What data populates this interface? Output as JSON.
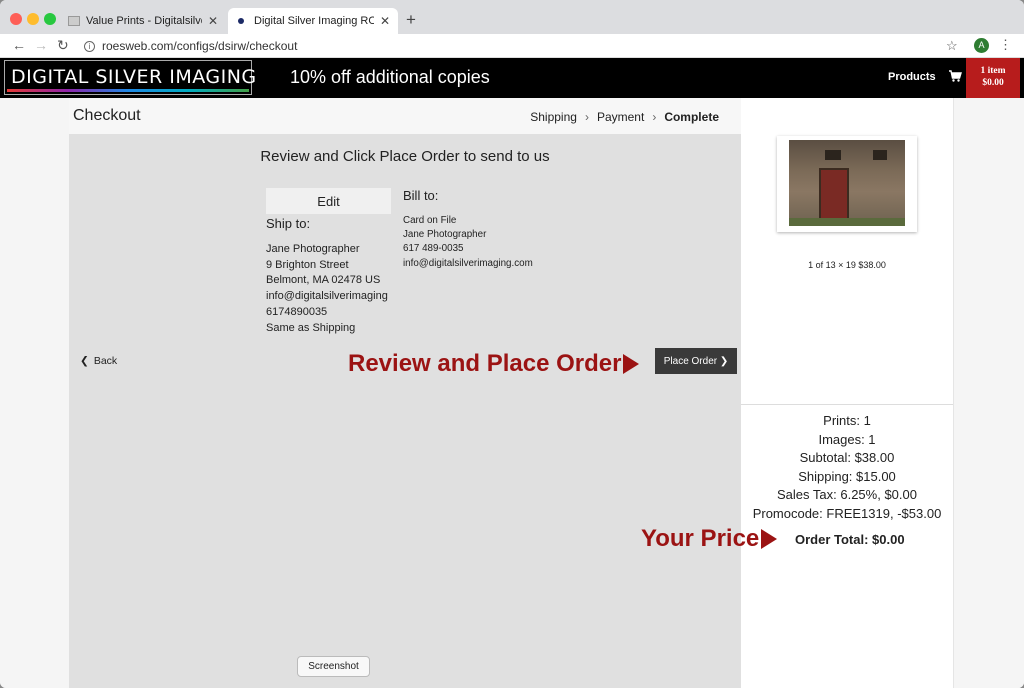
{
  "browser": {
    "tabs": [
      {
        "title": "Value Prints - Digitalsilverimag",
        "active": false
      },
      {
        "title": "Digital Silver Imaging ROES We",
        "active": true
      }
    ],
    "url": "roesweb.com/configs/dsirw/checkout",
    "profile_initial": "A"
  },
  "header": {
    "logo_text": "DIGITAL SILVER IMAGING",
    "promo": "10% off additional copies",
    "nav_products": "Products",
    "cart_line1": "1 item",
    "cart_line2": "$0.00"
  },
  "checkout": {
    "title": "Checkout",
    "steps": [
      "Shipping",
      "Payment",
      "Complete"
    ],
    "heading": "Review and Click Place Order to send to us",
    "edit_label": "Edit",
    "ship_to_title": "Ship to:",
    "ship_to": [
      "Jane Photographer",
      "9 Brighton Street",
      "Belmont, MA 02478 US",
      "info@digitalsilverimaging",
      "6174890035",
      "Same as Shipping"
    ],
    "bill_to_title": "Bill to:",
    "bill_to": [
      "Card on File",
      "Jane Photographer",
      "617 489-0035",
      "info@digitalsilverimaging.com"
    ],
    "back_label": "Back",
    "place_order_label": "Place Order",
    "annotation_review": "Review and Place Order",
    "tooltip": "Screenshot"
  },
  "sidebar": {
    "item_caption": "1 of 13 × 19 $38.00",
    "summary": [
      "Prints: 1",
      "Images: 1",
      "Subtotal: $38.00",
      "Shipping: $15.00",
      "Sales Tax: 6.25%, $0.00",
      "Promocode: FREE1319, -$53.00"
    ],
    "order_total": "Order Total: $0.00",
    "annotation_price": "Your Price"
  },
  "colors": {
    "annotation_red": "#9b1313",
    "cart_red": "#b71c1c",
    "header_black": "#000000"
  }
}
